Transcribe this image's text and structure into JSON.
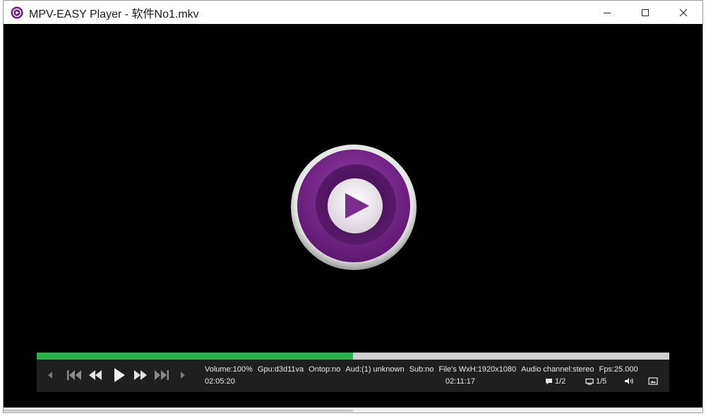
{
  "window": {
    "title": "MPV-EASY Player - 软件No1.mkv",
    "app_icon": "mpv-logo-icon",
    "controls": [
      "minimize-icon",
      "maximize-icon",
      "close-icon"
    ]
  },
  "player": {
    "center_icon": "big-play-icon",
    "progress_fraction": 0.5,
    "colors": {
      "progress": "#2cb14a",
      "track": "#cfcfcf",
      "controlbar": "#1f1f1f",
      "accent": "#7b2d8e"
    },
    "buttons": [
      "prev-icon",
      "skip-back-icon",
      "rewind-icon",
      "play-icon",
      "fast-forward-icon",
      "skip-forward-icon",
      "next-icon"
    ],
    "info": {
      "volume": "Volume:100%",
      "gpu": "Gpu:d3d11va",
      "ontop": "Ontop:no",
      "aud": "Aud:(1) unknown",
      "sub": "Sub:no",
      "file_size": "File's WxH:1920x1080",
      "audio_channel": "Audio channel:stereo",
      "fps": "Fps:25.000"
    },
    "current_time": "02:05:20",
    "total_time": "02:11:17",
    "subtitle_track": "1/2",
    "video_track": "1/5",
    "stat_icons": [
      "subtitle-icon",
      "video-track-icon",
      "volume-icon",
      "screenshot-icon"
    ]
  }
}
